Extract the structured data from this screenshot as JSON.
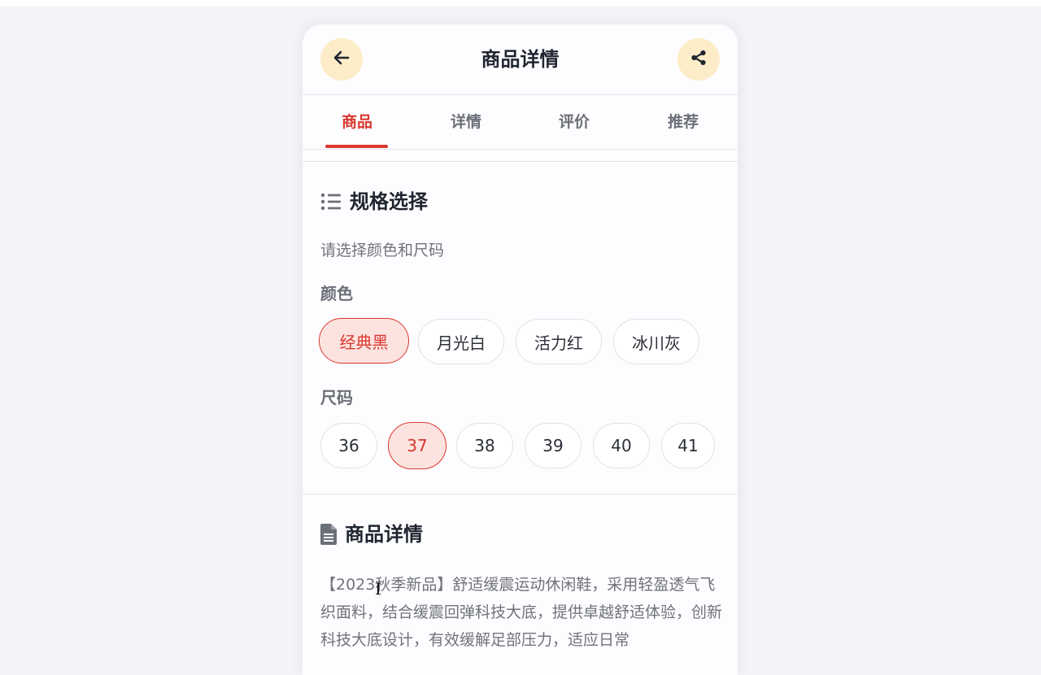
{
  "header": {
    "title": "商品详情",
    "back_icon": "arrow-left-icon",
    "share_icon": "share-icon",
    "button_bg": "#fcedc8"
  },
  "tabs": [
    {
      "label": "商品",
      "active": true
    },
    {
      "label": "详情",
      "active": false
    },
    {
      "label": "评价",
      "active": false
    },
    {
      "label": "推荐",
      "active": false
    }
  ],
  "spec": {
    "icon": "list-icon",
    "title": "规格选择",
    "hint": "请选择颜色和尺码",
    "color_label": "颜色",
    "colors": [
      {
        "label": "经典黑",
        "selected": true
      },
      {
        "label": "月光白",
        "selected": false
      },
      {
        "label": "活力红",
        "selected": false
      },
      {
        "label": "冰川灰",
        "selected": false
      }
    ],
    "size_label": "尺码",
    "sizes": [
      {
        "label": "36",
        "selected": false
      },
      {
        "label": "37",
        "selected": true
      },
      {
        "label": "38",
        "selected": false
      },
      {
        "label": "39",
        "selected": false
      },
      {
        "label": "40",
        "selected": false
      },
      {
        "label": "41",
        "selected": false
      }
    ]
  },
  "details": {
    "icon": "document-icon",
    "title": "商品详情",
    "description": "【2023秋季新品】舒适缓震运动休闲鞋，采用轻盈透气飞织面料，结合缓震回弹科技大底，提供卓越舒适体验，创新科技大底设计，有效缓解足部压力，适应日常"
  },
  "colors": {
    "accent": "#d9382f",
    "selected_bg": "#fde3e0",
    "title_text": "#1f2530"
  }
}
